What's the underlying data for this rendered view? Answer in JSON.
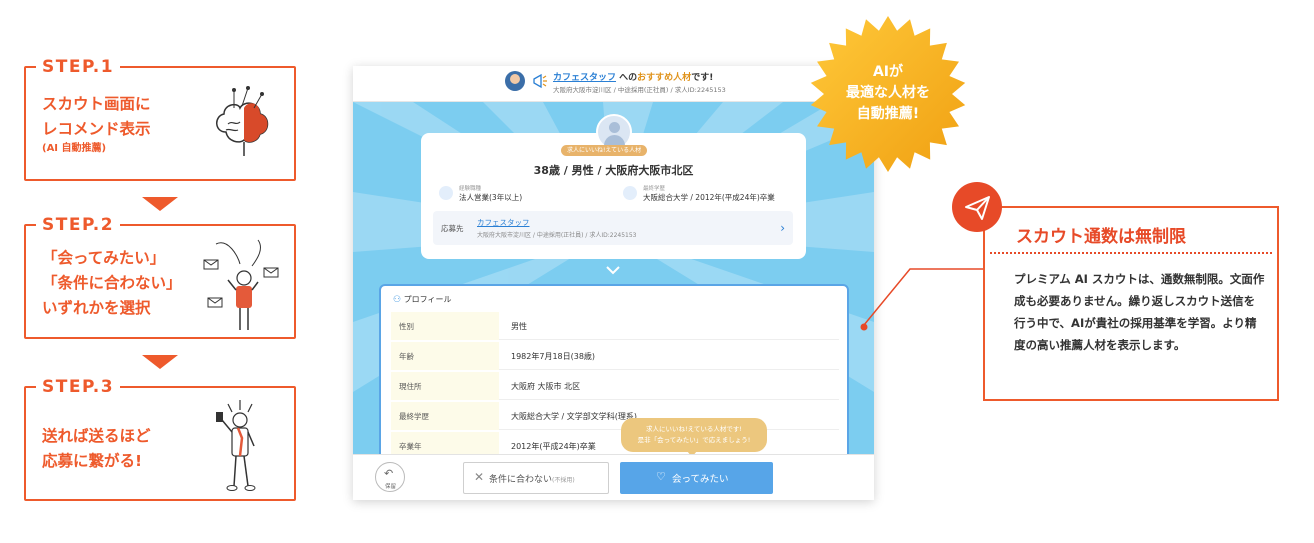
{
  "steps": [
    {
      "tag": "STEP.1",
      "lines": [
        "スカウト画面に",
        "レコメンド表示"
      ],
      "sub": "(AI 自動推薦)"
    },
    {
      "tag": "STEP.2",
      "lines": [
        "「会ってみたい」",
        "「条件に合わない」",
        "いずれかを選択"
      ]
    },
    {
      "tag": "STEP.3",
      "lines": [
        "送れば送るほど",
        "応募に繋がる!"
      ]
    }
  ],
  "mock": {
    "header": {
      "company": "カフェスタッフ",
      "to_text": "への",
      "recommend": "おすすめ人材",
      "suffix": "です!",
      "detail": "大阪府大阪市淀川区 / 中途採用(正社員) / 求人ID:2245153"
    },
    "card": {
      "badge": "求人にいいね!えている人材",
      "title": "38歳 / 男性 / 大阪府大阪市北区",
      "career_label": "経験職種",
      "career_value": "法人営業(3年以上)",
      "school_label": "最終学歴",
      "school_value": "大阪総合大学 / 2012年(平成24年)卒業",
      "apply_label": "応募先",
      "apply_name": "カフェスタッフ",
      "apply_detail": "大阪府大阪市淀川区 / 中途採用(正社員) / 求人ID:2245153"
    },
    "profile": {
      "heading": "プロフィール",
      "rows": [
        {
          "key": "性別",
          "value": "男性"
        },
        {
          "key": "年齢",
          "value": "1982年7月18日(38歳)"
        },
        {
          "key": "現住所",
          "value": "大阪府 大阪市 北区"
        },
        {
          "key": "最終学歴",
          "value": "大阪総合大学 / 文学部文学科(理系)"
        },
        {
          "key": "卒業年",
          "value": "2012年(平成24年)卒業"
        }
      ]
    },
    "tip": {
      "line1": "求人にいいね!えている人材です!",
      "line2": "是非「会ってみたい」で応えましょう!"
    },
    "footer": {
      "save_label": "保留",
      "no_label": "条件に合わない",
      "no_sub": "(不採用)",
      "yes_label": "会ってみたい"
    }
  },
  "burst": {
    "lines": [
      "AIが",
      "最適な人材を",
      "自動推薦!"
    ]
  },
  "callout": {
    "title": "スカウト通数は無制限",
    "body": "プレミアム AI スカウトは、通数無制限。文面作成も必要ありません。繰り返しスカウト送信を行う中で、AIが貴社の採用基準を学習。より精度の高い推薦人材を表示します。"
  },
  "colors": {
    "accent": "#ee5a2c",
    "blue": "#57a5e8",
    "gold": "#f2a81d",
    "sky": "#7ccdf0"
  },
  "icons": [
    "brain-icon",
    "person-letters-icon",
    "person-phone-icon",
    "paper-plane-icon",
    "megaphone-icon",
    "graduation-cap-icon",
    "heart-icon",
    "undo-icon",
    "user-icon"
  ]
}
